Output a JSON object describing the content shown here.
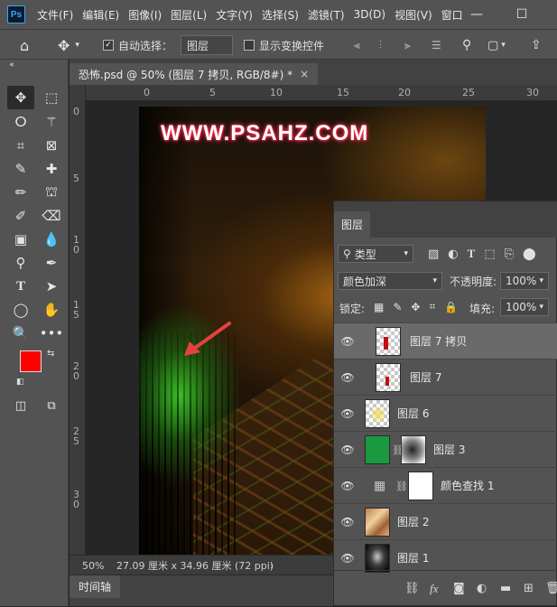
{
  "app": {
    "logo": "Ps"
  },
  "menu": [
    "文件(F)",
    "编辑(E)",
    "图像(I)",
    "图层(L)",
    "文字(Y)",
    "选择(S)",
    "滤镜(T)",
    "3D(D)",
    "视图(V)",
    "窗口"
  ],
  "window_controls": {
    "minimize": "—",
    "maximize": "☐"
  },
  "options": {
    "auto_select_label": "自动选择：",
    "auto_select_checked": true,
    "auto_select_target": "图层",
    "show_transform_label": "显示变换控件",
    "show_transform_checked": false
  },
  "document": {
    "tab_title": "恐怖.psd @ 50% (图层 7 拷贝, RGB/8#) *",
    "close_glyph": "×",
    "watermark": "WWW.PSAHZ.COM",
    "zoom": "50%",
    "doc_info": "27.09 厘米 x 34.96 厘米 (72 ppi)",
    "status_arrow": "›"
  },
  "rulers": {
    "top": [
      "0",
      "5",
      "10",
      "15",
      "20",
      "25",
      "30"
    ],
    "left": [
      "0",
      "5",
      "1\n0",
      "1\n5",
      "2\n0",
      "2\n5",
      "3\n0"
    ]
  },
  "colors": {
    "foreground": "#ff0000",
    "background": "#ffffff",
    "accent": "#31a8ff"
  },
  "timeline": {
    "tab_label": "时间轴"
  },
  "layers_panel": {
    "tab_label": "图层",
    "filter_label": "类型",
    "blend_mode": "颜色加深",
    "opacity_label": "不透明度:",
    "opacity_value": "100%",
    "lock_label": "锁定:",
    "fill_label": "填充:",
    "fill_value": "100%",
    "layers": [
      {
        "name": "图层 7 拷贝",
        "selected": true
      },
      {
        "name": "图层 7",
        "selected": false
      },
      {
        "name": "图层 6",
        "selected": false
      },
      {
        "name": "图层 3",
        "selected": false
      },
      {
        "name": "颜色查找 1",
        "selected": false
      },
      {
        "name": "图层 2",
        "selected": false
      },
      {
        "name": "图层 1",
        "selected": false
      }
    ]
  }
}
